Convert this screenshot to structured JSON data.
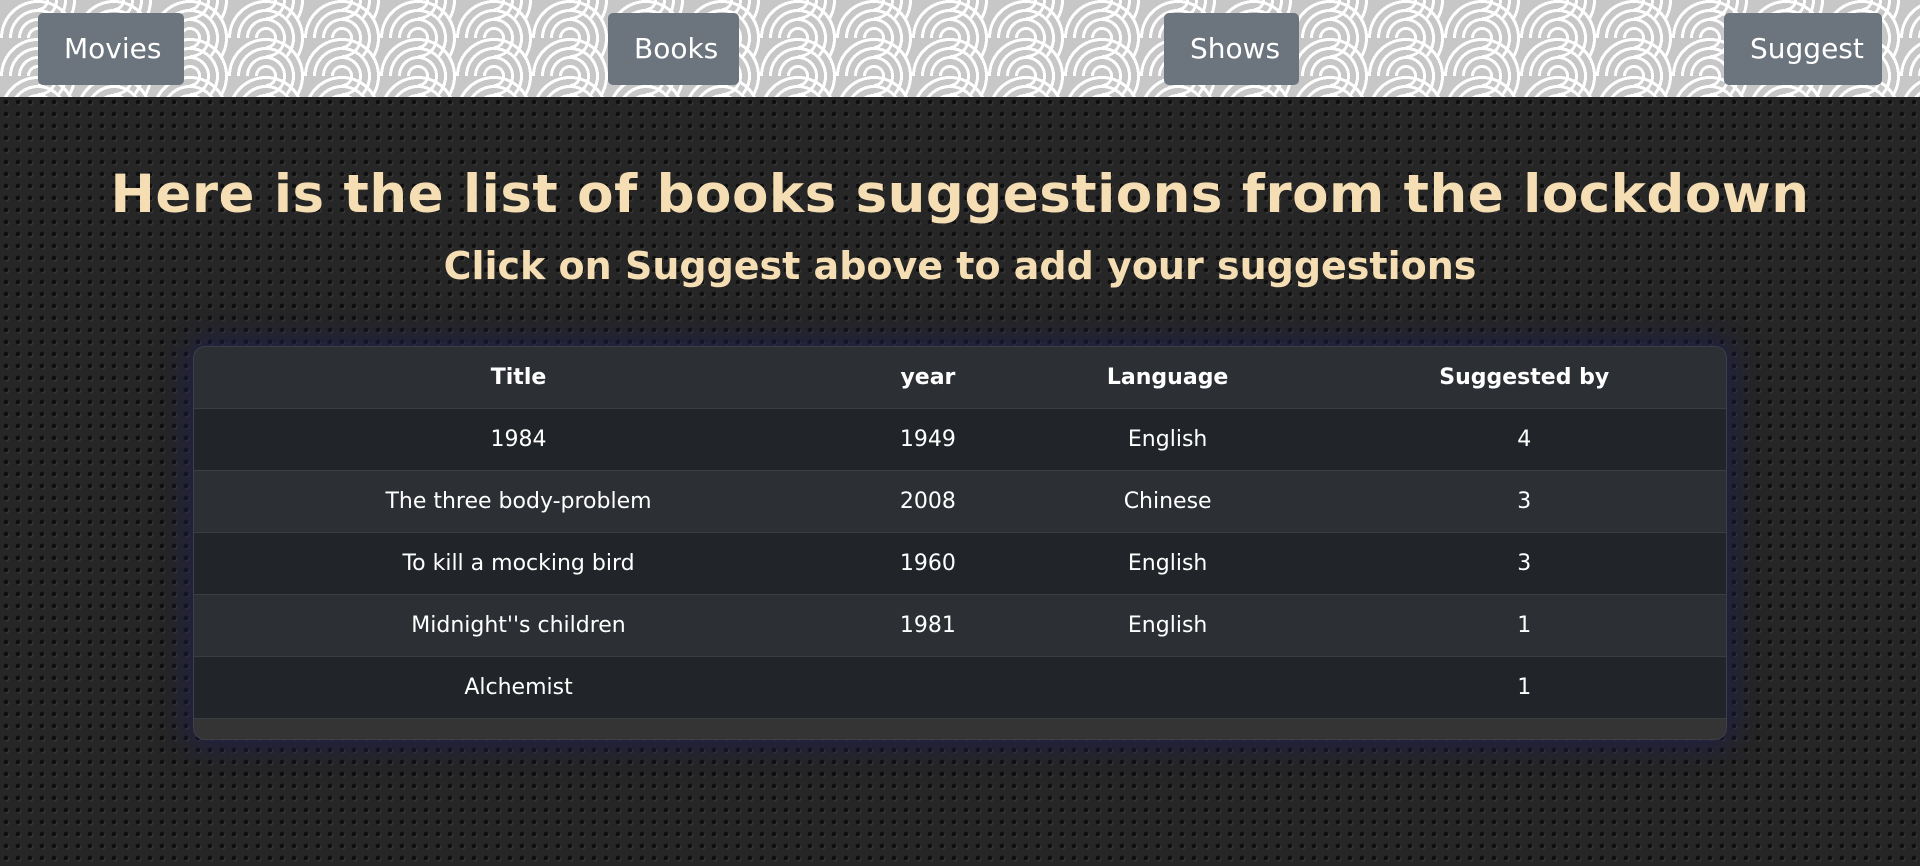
{
  "nav": {
    "movies": "Movies",
    "books": "Books",
    "shows": "Shows",
    "suggest": "Suggest"
  },
  "header": {
    "title": "Here is the list of books suggestions from the lockdown",
    "subtitle": "Click on Suggest above to add your suggestions"
  },
  "table": {
    "columns": [
      "Title",
      "year",
      "Language",
      "Suggested by"
    ],
    "rows": [
      [
        "1984",
        "1949",
        "English",
        "4"
      ],
      [
        "The three body-problem",
        "2008",
        "Chinese",
        "3"
      ],
      [
        "To kill a mocking bird",
        "1960",
        "English",
        "3"
      ],
      [
        "Midnight''s children",
        "1981",
        "English",
        "1"
      ],
      [
        "Alchemist",
        "",
        "",
        "1"
      ]
    ]
  },
  "colors": {
    "heading": "#f5deb3",
    "button": "#6c757d",
    "table_header": "#2c3035",
    "table_row_dark": "#212529"
  }
}
